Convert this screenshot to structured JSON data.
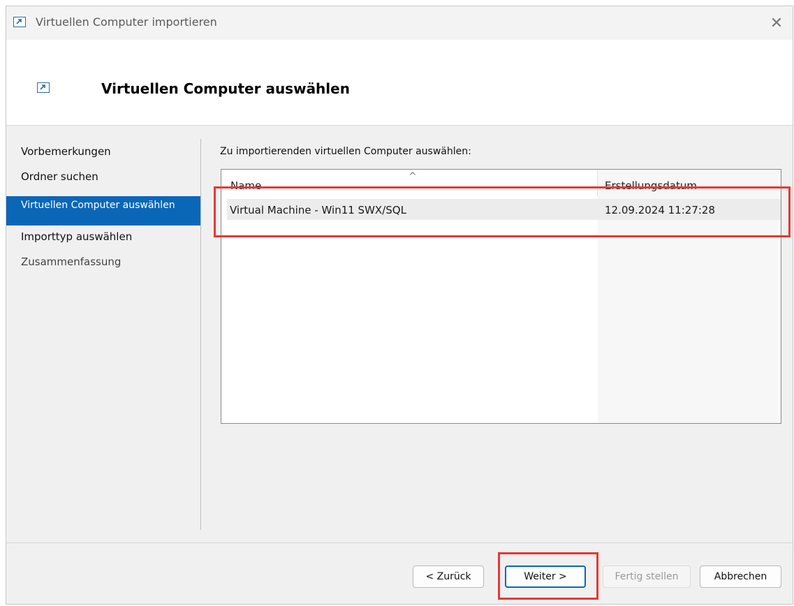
{
  "window": {
    "title": "Virtuellen Computer importieren",
    "close_symbol": "✕"
  },
  "header": {
    "title": "Virtuellen Computer auswählen"
  },
  "nav": {
    "items": [
      {
        "label": "Vorbemerkungen",
        "state": "normal"
      },
      {
        "label": "Ordner suchen",
        "state": "normal"
      },
      {
        "label": "Virtuellen Computer auswählen",
        "state": "active"
      },
      {
        "label": "Importtyp auswählen",
        "state": "normal"
      },
      {
        "label": "Zusammenfassung",
        "state": "disabled"
      }
    ]
  },
  "main": {
    "instruction": "Zu importierenden virtuellen Computer auswählen:",
    "columns": {
      "name": "Name",
      "date": "Erstellungsdatum"
    },
    "sort_indicator": "^",
    "rows": [
      {
        "name": "Virtual Machine - Win11 SWX/SQL",
        "date": "12.09.2024 11:27:28"
      }
    ]
  },
  "buttons": {
    "back": "< Zurück",
    "next": "Weiter >",
    "finish": "Fertig stellen",
    "cancel": "Abbrechen"
  },
  "colors": {
    "accent": "#0a67b8",
    "highlight": "#e53935"
  },
  "icons": {
    "app": "import-vm-icon",
    "header": "import-vm-icon"
  }
}
